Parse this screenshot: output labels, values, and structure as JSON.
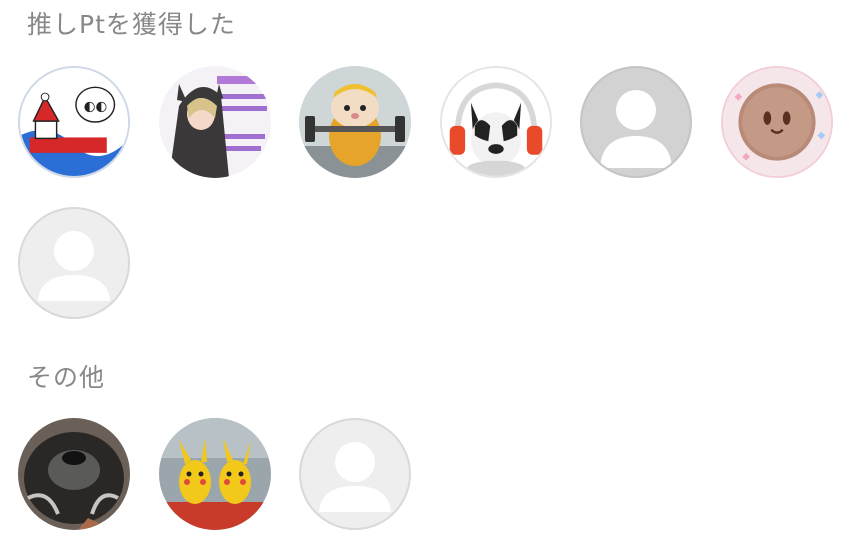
{
  "sections": [
    {
      "title": "推しPtを獲得した",
      "avatars": [
        {
          "kind": "image",
          "icon": "santa-drawing-avatar"
        },
        {
          "kind": "image",
          "icon": "anime-character-avatar"
        },
        {
          "kind": "image",
          "icon": "hamster-weightlifter-avatar"
        },
        {
          "kind": "image",
          "icon": "bulldog-headphones-avatar"
        },
        {
          "kind": "placeholder",
          "icon": "default-user-icon"
        },
        {
          "kind": "image",
          "icon": "kirby-cookie-avatar"
        },
        {
          "kind": "placeholder",
          "icon": "default-user-icon"
        }
      ]
    },
    {
      "title": "その他",
      "avatars": [
        {
          "kind": "image",
          "icon": "dog-closeup-avatar"
        },
        {
          "kind": "image",
          "icon": "pikachu-statues-avatar"
        },
        {
          "kind": "placeholder",
          "icon": "default-user-icon"
        }
      ]
    }
  ],
  "colors": {
    "title": "#888888",
    "placeholder_bg": "#eeeeee",
    "placeholder_icon": "#ffffff"
  }
}
